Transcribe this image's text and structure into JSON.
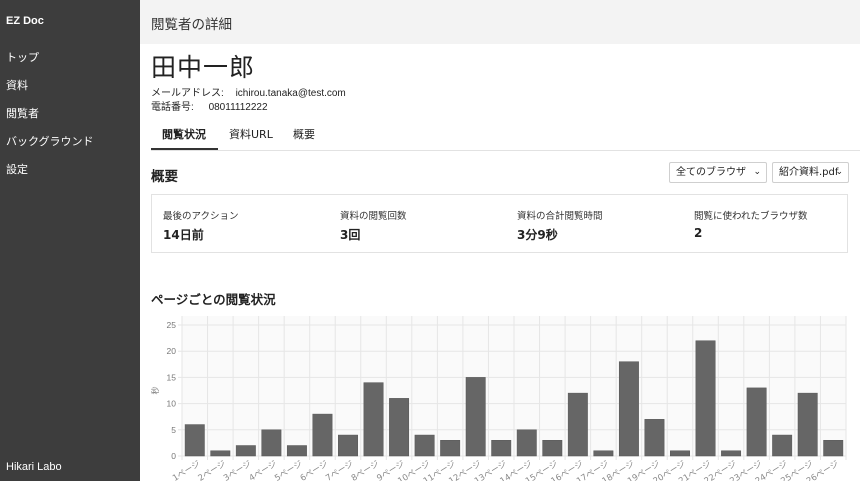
{
  "sidebar": {
    "brand": "EZ Doc",
    "items": [
      "トップ",
      "資料",
      "閲覧者",
      "バックグラウンド",
      "設定"
    ],
    "footer": "Hikari Labo"
  },
  "header": {
    "title": "閲覧者の詳細"
  },
  "viewer": {
    "name": "田中一郎",
    "email_label": "メールアドレス:",
    "email": "ichirou.tanaka@test.com",
    "phone_label": "電話番号:",
    "phone": "08011112222"
  },
  "tabs": [
    "閲覧状況",
    "資料URL",
    "概要"
  ],
  "overview": {
    "title": "概要",
    "browser_select": "全てのブラウザ",
    "doc_select": "紹介資料.pdf",
    "stats": [
      {
        "label": "最後のアクション",
        "value": "14日前"
      },
      {
        "label": "資料の閲覧回数",
        "value": "3回"
      },
      {
        "label": "資料の合計閲覧時間",
        "value": "3分9秒"
      },
      {
        "label": "閲覧に使われたブラウザ数",
        "value": "2"
      }
    ]
  },
  "chart_section": {
    "title": "ページごとの閲覧状況"
  },
  "chart_data": {
    "type": "bar",
    "ylabel": "秒",
    "ylim": [
      0,
      25
    ],
    "yticks": [
      0,
      5,
      10,
      15,
      20,
      25
    ],
    "values": [
      6,
      1,
      2,
      5,
      2,
      8,
      4,
      14,
      11,
      4,
      3,
      15,
      3,
      5,
      3,
      12,
      1,
      18,
      7,
      1,
      22,
      1,
      13,
      4,
      12,
      3
    ],
    "bar_color": "#666666",
    "grid": true,
    "category_suffix": "ページ"
  }
}
